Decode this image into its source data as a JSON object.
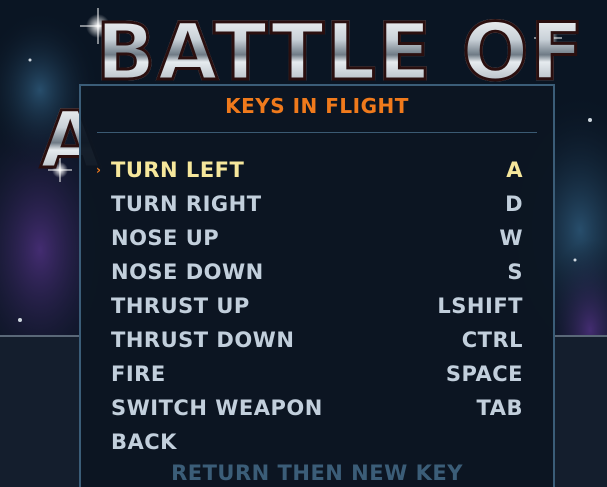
{
  "game_title": "BATTLE OF",
  "game_title_line2": "A",
  "menu": {
    "title": "KEYS IN FLIGHT",
    "selected_index": 0,
    "items": [
      {
        "label": "TURN LEFT",
        "key": "A"
      },
      {
        "label": "TURN RIGHT",
        "key": "D"
      },
      {
        "label": "NOSE UP",
        "key": "W"
      },
      {
        "label": "NOSE DOWN",
        "key": "S"
      },
      {
        "label": "THRUST UP",
        "key": "LSHIFT"
      },
      {
        "label": "THRUST DOWN",
        "key": "CTRL"
      },
      {
        "label": "FIRE",
        "key": "SPACE"
      },
      {
        "label": "SWITCH WEAPON",
        "key": "TAB"
      },
      {
        "label": "BACK",
        "key": ""
      }
    ],
    "hint": "RETURN THEN NEW KEY",
    "cursor_glyph": "›"
  },
  "colors": {
    "title_orange": "#f07a1c",
    "selected_yellow": "#f6e79c",
    "item_grey": "#c2cfdc",
    "panel_border": "#3b5d78"
  }
}
